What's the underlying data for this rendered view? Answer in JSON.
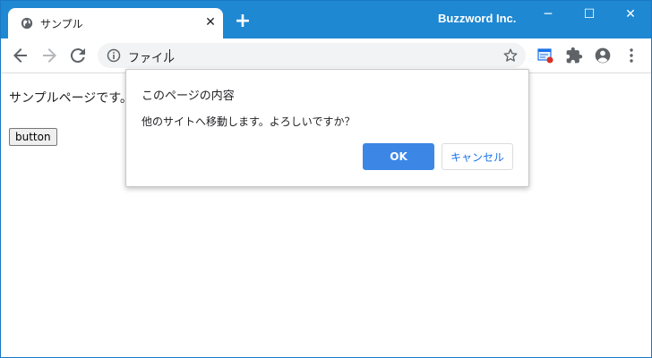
{
  "browser": {
    "tab": {
      "title": "サンプル",
      "close_glyph": "✕",
      "favicon": "globe-icon"
    },
    "new_tab_glyph": "+",
    "org_name": "Buzzword Inc.",
    "window_controls": {
      "minimize": "─",
      "maximize": "☐",
      "close": "✕"
    },
    "address_bar": {
      "text": "ファイル"
    }
  },
  "page": {
    "text": "サンプルページです。",
    "button_label": "button"
  },
  "dialog": {
    "title": "このページの内容",
    "message": "他のサイトへ移動します。よろしいですか？",
    "ok_label": "OK",
    "cancel_label": "キャンセル"
  },
  "colors": {
    "titlebar": "#1e88d2",
    "accent": "#3c87e6",
    "link": "#1a73e8"
  }
}
